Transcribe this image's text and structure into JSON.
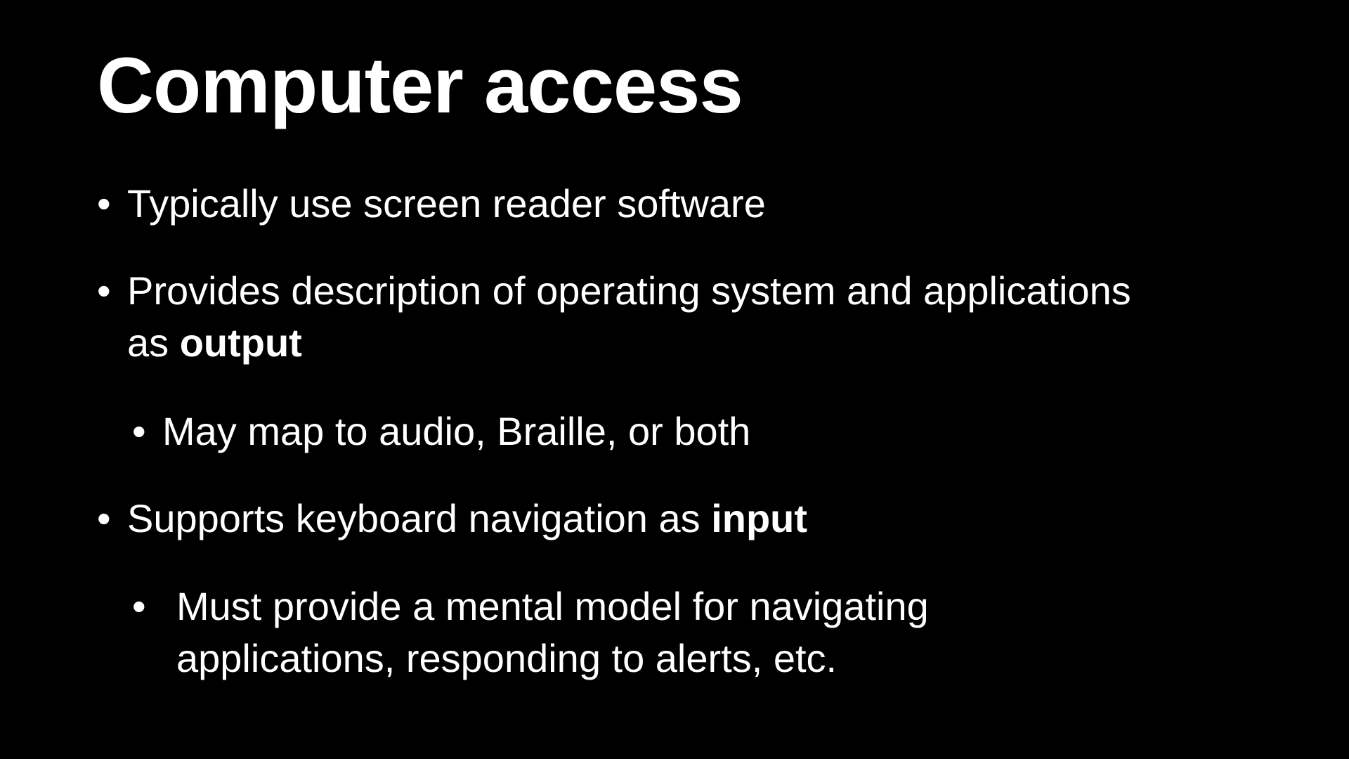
{
  "slide": {
    "title": "Computer access",
    "bullet_glyph": "•",
    "bullets": [
      {
        "level": 1,
        "text": "Typically use screen reader software"
      },
      {
        "level": 1,
        "text_line1": "Provides description of operating system and applications",
        "text_line2_pre": "as ",
        "text_line2_bold": "output"
      },
      {
        "level": 2,
        "text": "May map to audio, Braille, or both"
      },
      {
        "level": 1,
        "text_pre": "Supports keyboard navigation as ",
        "text_bold": "input"
      },
      {
        "level": 2,
        "text_line1": "Must provide a mental model for navigating",
        "text_line2": "applications, responding to alerts, etc."
      }
    ]
  },
  "colors": {
    "background": "#000000",
    "text": "#ffffff"
  }
}
